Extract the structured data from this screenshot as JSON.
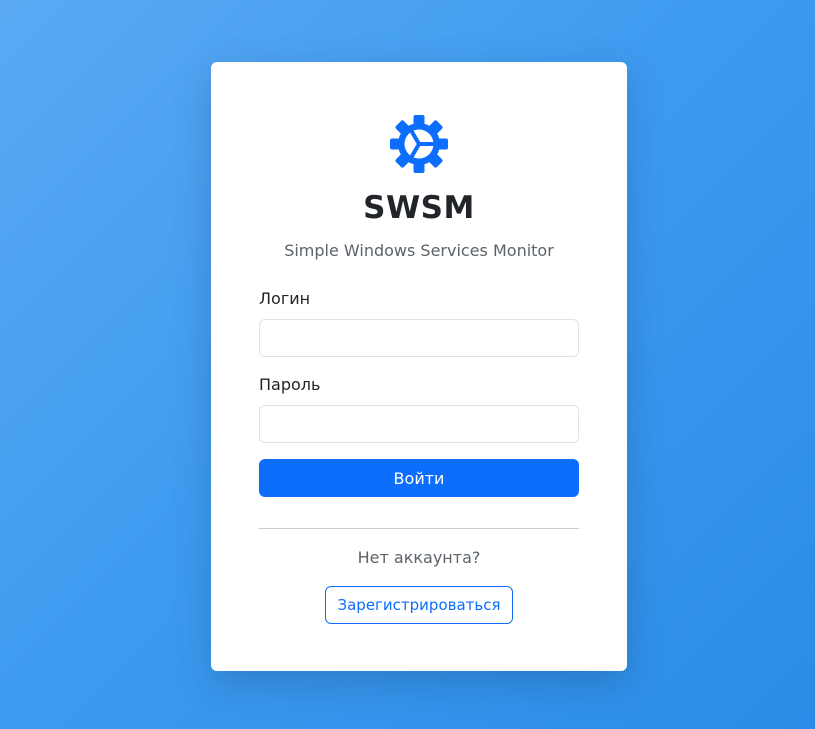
{
  "brand": {
    "title": "SWSM",
    "subtitle": "Simple Windows Services Monitor",
    "icon": "gear-icon",
    "accent_color": "#0d6efd"
  },
  "form": {
    "login_label": "Логин",
    "login_value": "",
    "password_label": "Пароль",
    "password_value": "",
    "submit_label": "Войти"
  },
  "register": {
    "prompt": "Нет аккаунта?",
    "button_label": "Зарегистрироваться"
  }
}
